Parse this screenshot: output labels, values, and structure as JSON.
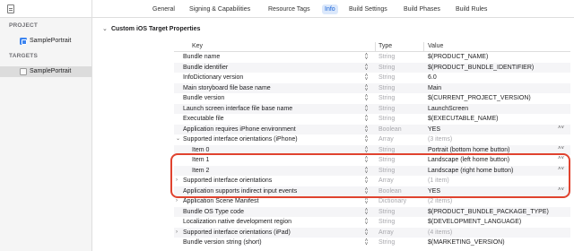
{
  "tabs": [
    {
      "label": "General",
      "active": false
    },
    {
      "label": "Signing & Capabilities",
      "active": false
    },
    {
      "label": "Resource Tags",
      "active": false
    },
    {
      "label": "Info",
      "active": true
    },
    {
      "label": "Build Settings",
      "active": false
    },
    {
      "label": "Build Phases",
      "active": false
    },
    {
      "label": "Build Rules",
      "active": false
    }
  ],
  "sidebar": {
    "project_heading": "PROJECT",
    "project_item": "SamplePortrait",
    "targets_heading": "TARGETS",
    "target_item": "SamplePortrait"
  },
  "section": {
    "title": "Custom iOS Target Properties"
  },
  "table": {
    "headers": {
      "key": "Key",
      "type": "Type",
      "value": "Value"
    },
    "rows": [
      {
        "key": "Bundle name",
        "type": "String",
        "value": "$(PRODUCT_NAME)"
      },
      {
        "key": "Bundle identifier",
        "type": "String",
        "value": "$(PRODUCT_BUNDLE_IDENTIFIER)"
      },
      {
        "key": "InfoDictionary version",
        "type": "String",
        "value": "6.0"
      },
      {
        "key": "Main storyboard file base name",
        "type": "String",
        "value": "Main"
      },
      {
        "key": "Bundle version",
        "type": "String",
        "value": "$(CURRENT_PROJECT_VERSION)"
      },
      {
        "key": "Launch screen interface file base name",
        "type": "String",
        "value": "LaunchScreen"
      },
      {
        "key": "Executable file",
        "type": "String",
        "value": "$(EXECUTABLE_NAME)"
      },
      {
        "key": "Application requires iPhone environment",
        "type": "Boolean",
        "value": "YES"
      },
      {
        "key": "Supported interface orientations (iPhone)",
        "type": "Array",
        "value": "(3 items)"
      },
      {
        "key": "Item 0",
        "type": "String",
        "value": "Portrait (bottom home button)"
      },
      {
        "key": "Item 1",
        "type": "String",
        "value": "Landscape (left home button)"
      },
      {
        "key": "Item 2",
        "type": "String",
        "value": "Landscape (right home button)"
      },
      {
        "key": "Supported interface orientations",
        "type": "Array",
        "value": "(1 item)"
      },
      {
        "key": "Application supports indirect input events",
        "type": "Boolean",
        "value": "YES"
      },
      {
        "key": "Application Scene Manifest",
        "type": "Dictionary",
        "value": "(2 items)"
      },
      {
        "key": "Bundle OS Type code",
        "type": "String",
        "value": "$(PRODUCT_BUNDLE_PACKAGE_TYPE)"
      },
      {
        "key": "Localization native development region",
        "type": "String",
        "value": "$(DEVELOPMENT_LANGUAGE)"
      },
      {
        "key": "Supported interface orientations (iPad)",
        "type": "Array",
        "value": "(4 items)"
      },
      {
        "key": "Bundle version string (short)",
        "type": "String",
        "value": "$(MARKETING_VERSION)"
      }
    ]
  },
  "icons": {
    "section_chevron": "chevron-down-icon",
    "expanded": "chevron-down-icon",
    "collapsed": "chevron-right-icon",
    "stepper": "up-down-arrows-icon"
  },
  "colors": {
    "accent": "#1a63d6",
    "highlight_border": "#e0432f",
    "muted_text": "#a8a8ad"
  }
}
